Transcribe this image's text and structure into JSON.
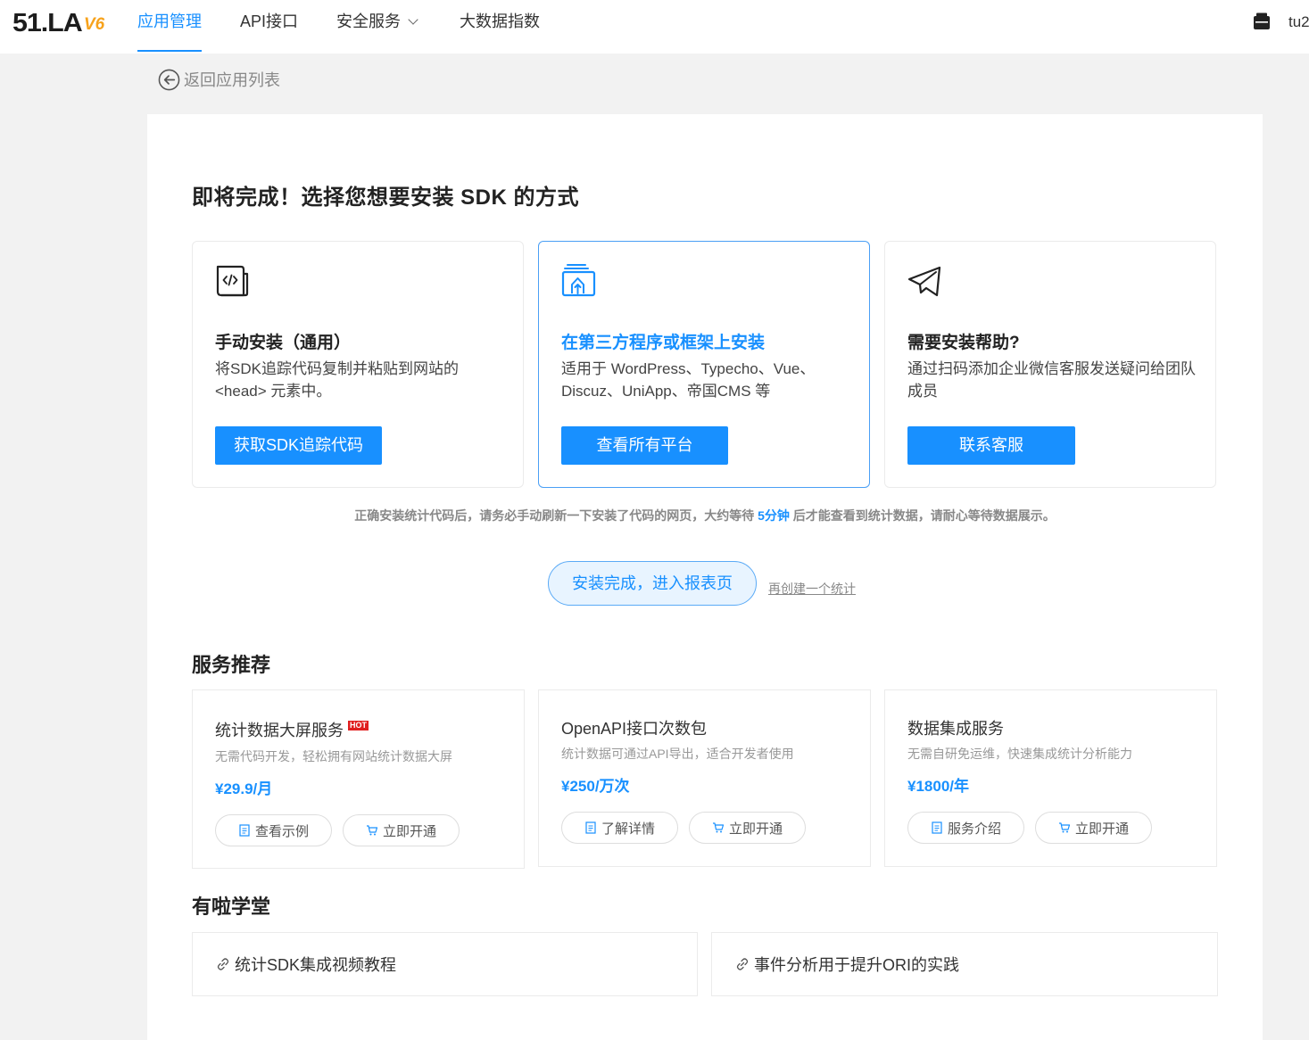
{
  "nav": {
    "logo_main": "51.LA",
    "logo_version": "V6",
    "items": [
      {
        "label": "应用管理",
        "active": true
      },
      {
        "label": "API接口",
        "active": false
      },
      {
        "label": "安全服务",
        "active": false,
        "dropdown": true
      },
      {
        "label": "大数据指数",
        "active": false
      }
    ],
    "user": "tu2"
  },
  "back": {
    "label": "返回应用列表"
  },
  "title": "即将完成！选择您想要安装 SDK 的方式",
  "options": [
    {
      "icon": "code-file-icon",
      "title": "手动安装（通用）",
      "desc": "将SDK追踪代码复制并粘贴到网站的<head> 元素中。",
      "button": "获取SDK追踪代码"
    },
    {
      "icon": "platform-upload-icon",
      "title": "在第三方程序或框架上安装",
      "desc": "适用于 WordPress、Typecho、Vue、Discuz、UniApp、帝国CMS 等",
      "button": "查看所有平台"
    },
    {
      "icon": "paper-plane-icon",
      "title": "需要安装帮助?",
      "desc": "通过扫码添加企业微信客服发送疑问给团队成员",
      "button": "联系客服"
    }
  ],
  "notice": {
    "before": "正确安装统计代码后，请务必手动刷新一下安装了代码的网页，大约等待 ",
    "highlight": "5分钟",
    "after": " 后才能查看到统计数据，请耐心等待数据展示。"
  },
  "finish_button": "安装完成，进入报表页",
  "recreate_link": "再创建一个统计",
  "services": {
    "title": "服务推荐",
    "items": [
      {
        "name": "统计数据大屏服务",
        "badge": "HOT",
        "desc": "无需代码开发，轻松拥有网站统计数据大屏",
        "price": "¥29.9/月",
        "btn1": "查看示例",
        "btn2": "立即开通"
      },
      {
        "name": "OpenAPI接口次数包",
        "badge": "",
        "desc": "统计数据可通过API导出，适合开发者使用",
        "price": "¥250/万次",
        "btn1": "了解详情",
        "btn2": "立即开通"
      },
      {
        "name": "数据集成服务",
        "badge": "",
        "desc": "无需自研免运维，快速集成统计分析能力",
        "price": "¥1800/年",
        "btn1": "服务介绍",
        "btn2": "立即开通"
      }
    ]
  },
  "academy": {
    "title": "有啦学堂",
    "items": [
      {
        "label": "统计SDK集成视频教程"
      },
      {
        "label": "事件分析用于提升ORI的实践"
      }
    ]
  },
  "colors": {
    "accent": "#1890ff",
    "hot": "#e02020",
    "logo_version": "#f7a21b"
  }
}
